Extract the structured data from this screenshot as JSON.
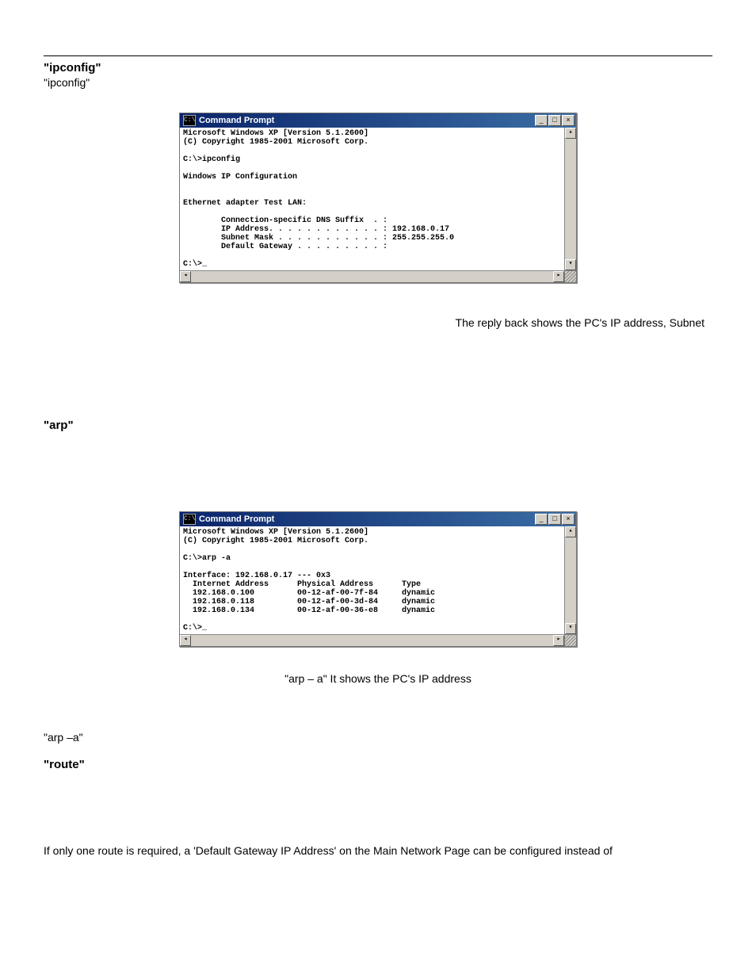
{
  "headings": {
    "ipconfig": "\"ipconfig\"",
    "ipconfig_sub": "\"ipconfig\"",
    "arp": "\"arp\"",
    "arp_inline": "\"arp –a\"",
    "route": "\"route\""
  },
  "console": {
    "title": "Command Prompt",
    "icon_glyph": "C:\\",
    "minimize": "_",
    "maximize": "□",
    "close": "×",
    "v_up": "▴",
    "v_down": "▾",
    "h_left": "◂",
    "h_right": "▸"
  },
  "ipconfig_output": "Microsoft Windows XP [Version 5.1.2600]\n(C) Copyright 1985-2001 Microsoft Corp.\n\nC:\\>ipconfig\n\nWindows IP Configuration\n\n\nEthernet adapter Test LAN:\n\n        Connection-specific DNS Suffix  . :\n        IP Address. . . . . . . . . . . . : 192.168.0.17\n        Subnet Mask . . . . . . . . . . . : 255.255.255.0\n        Default Gateway . . . . . . . . . :\n\nC:\\>_\n",
  "arp_output": "Microsoft Windows XP [Version 5.1.2600]\n(C) Copyright 1985-2001 Microsoft Corp.\n\nC:\\>arp -a\n\nInterface: 192.168.0.17 --- 0x3\n  Internet Address      Physical Address      Type\n  192.168.0.100         00-12-af-00-7f-84     dynamic\n  192.168.0.118         00-12-af-00-3d-84     dynamic\n  192.168.0.134         00-12-af-00-36-e8     dynamic\n\nC:\\>_",
  "captions": {
    "ipconfig_reply": "The reply back shows the PC's IP address, Subnet",
    "arp_fig": "\"arp – a\"  It shows the PC's IP address"
  },
  "route_para": "If only one route is required, a 'Default Gateway IP Address' on the Main Network Page can be configured instead of"
}
